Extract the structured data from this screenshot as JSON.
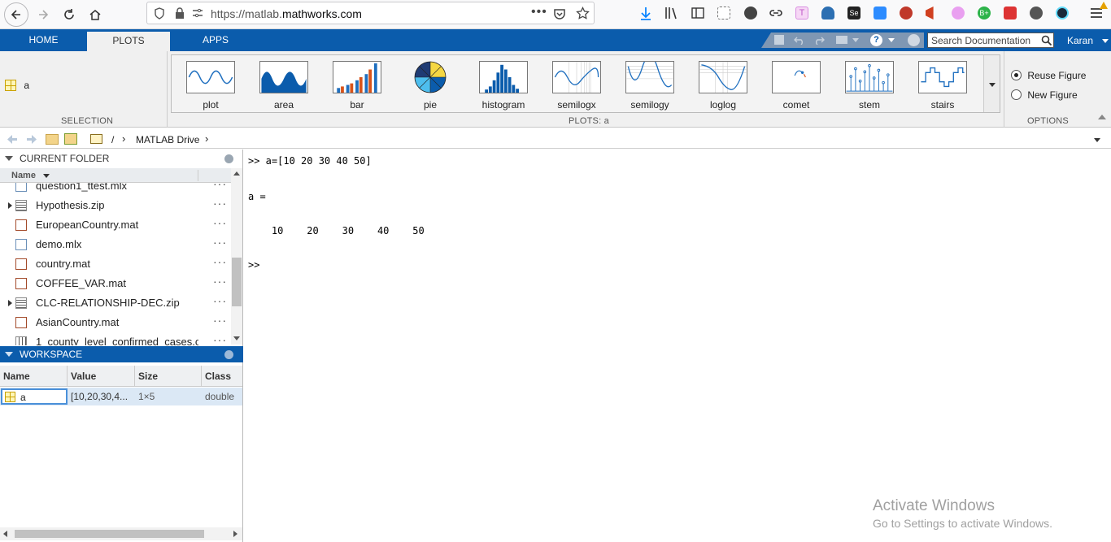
{
  "browser": {
    "url_prefix": "https://matlab.",
    "url_domain": "mathworks.com",
    "more_icon": "ellipsis-icon"
  },
  "tabs": [
    {
      "label": "HOME"
    },
    {
      "label": "PLOTS"
    },
    {
      "label": "APPS"
    }
  ],
  "header": {
    "search_placeholder": "Search Documentation",
    "user": "Karan"
  },
  "selection": {
    "variable": "a",
    "section_label": "SELECTION"
  },
  "plots": {
    "section_label": "PLOTS: a",
    "items": [
      "plot",
      "area",
      "bar",
      "pie",
      "histogram",
      "semilogx",
      "semilogy",
      "loglog",
      "comet",
      "stem",
      "stairs"
    ]
  },
  "options": {
    "section_label": "OPTIONS",
    "reuse": "Reuse Figure",
    "new": "New Figure",
    "selected": "Reuse Figure"
  },
  "address": {
    "root": "/",
    "folder": "MATLAB Drive"
  },
  "current_folder": {
    "title": "CURRENT FOLDER",
    "name_header": "Name",
    "files": [
      {
        "name": "question1_ttest.mlx"
      },
      {
        "name": "Hypothesis.zip"
      },
      {
        "name": "EuropeanCountry.mat"
      },
      {
        "name": "demo.mlx"
      },
      {
        "name": "country.mat"
      },
      {
        "name": "COFFEE_VAR.mat"
      },
      {
        "name": "CLC-RELATIONSHIP-DEC.zip"
      },
      {
        "name": "AsianCountry.mat"
      },
      {
        "name": "1_county_level_confirmed_cases.c"
      }
    ]
  },
  "workspace": {
    "title": "WORKSPACE",
    "columns": [
      "Name",
      "Value",
      "Size",
      "Class"
    ],
    "rows": [
      {
        "name": "a",
        "value": "[10,20,30,4...",
        "size": "1×5",
        "class": "double"
      }
    ]
  },
  "command_window": {
    "lines": [
      ">> a=[10 20 30 40 50]",
      "a =",
      "    10    20    30    40    50",
      ">>"
    ]
  },
  "watermark": {
    "title": "Activate Windows",
    "subtitle": "Go to Settings to activate Windows."
  }
}
